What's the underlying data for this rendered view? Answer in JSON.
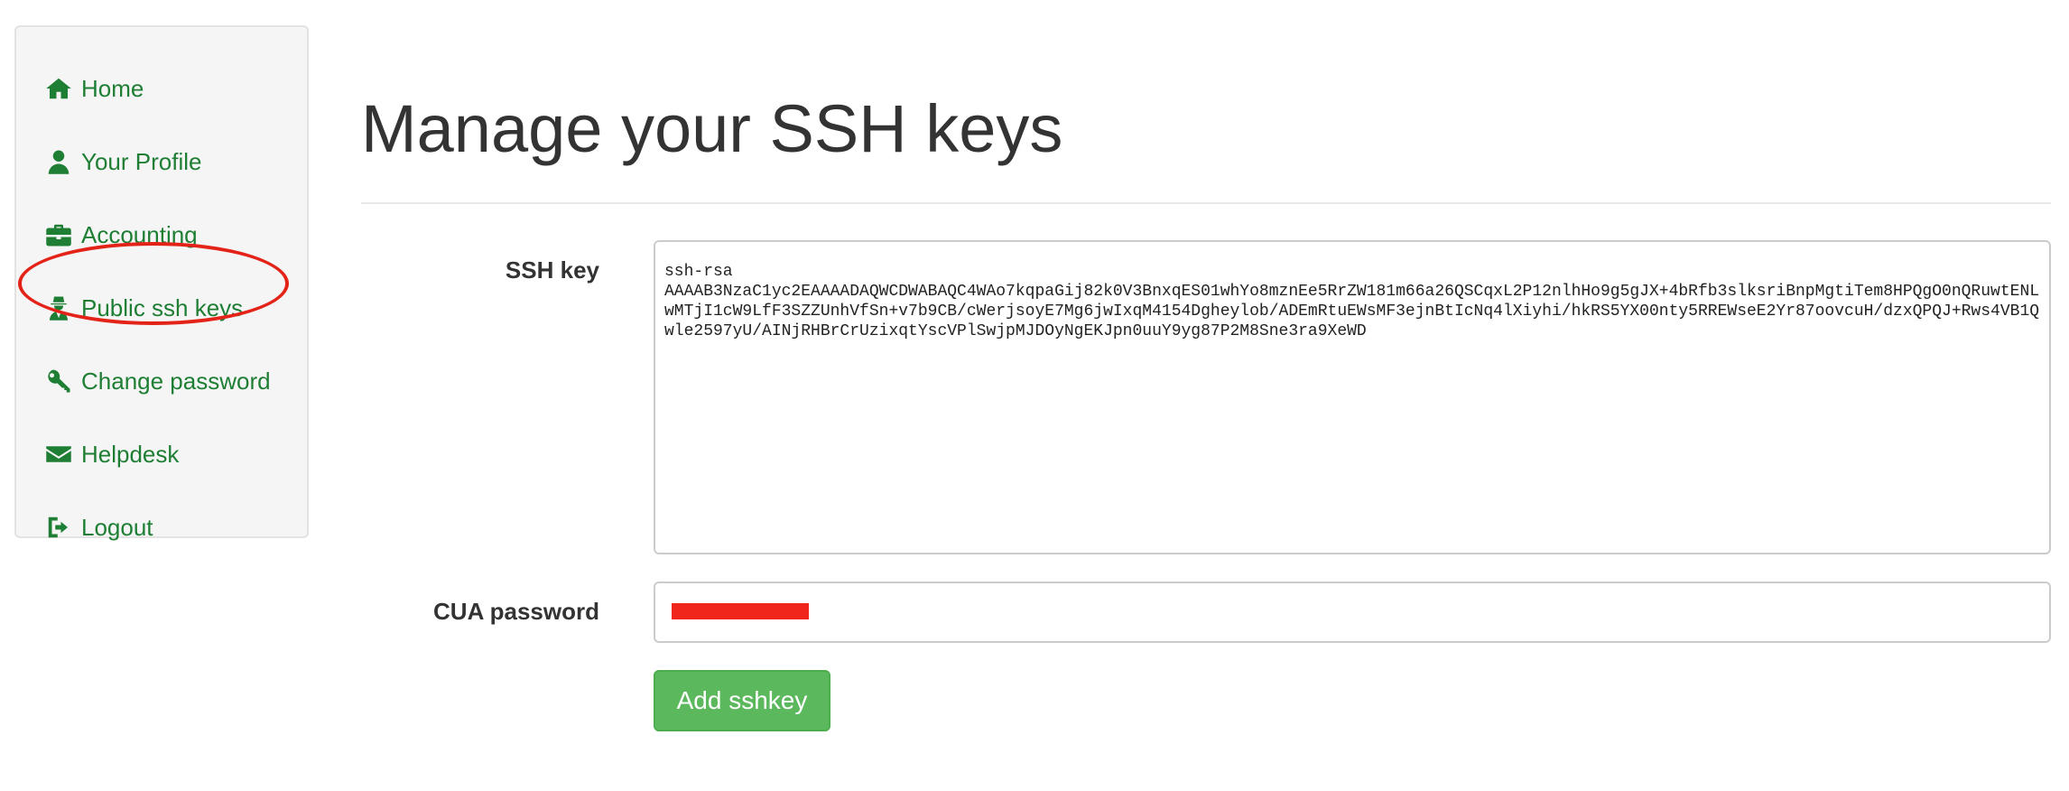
{
  "colors": {
    "link": "#1e7e34",
    "button": "#5cb85c",
    "highlight": "#e32218",
    "redaction": "#f0261c"
  },
  "sidebar": {
    "items": [
      {
        "label": "Home",
        "icon": "home-icon"
      },
      {
        "label": "Your Profile",
        "icon": "user-icon"
      },
      {
        "label": "Accounting",
        "icon": "briefcase-icon"
      },
      {
        "label": "Public ssh keys",
        "icon": "user-secret-icon",
        "highlighted": true
      },
      {
        "label": "Change password",
        "icon": "key-icon"
      },
      {
        "label": "Helpdesk",
        "icon": "envelope-icon"
      },
      {
        "label": "Logout",
        "icon": "sign-out-icon"
      }
    ]
  },
  "main": {
    "title": "Manage your SSH keys",
    "form": {
      "ssh_key_label": "SSH key",
      "ssh_key_value": "ssh-rsa\nAAAAB3NzaC1yc2EAAAADAQWCDWABAQC4WAo7kqpaGij82k0V3BnxqES01whYo8mznEe5RrZW181m66a26QSCqxL2P12nlhHo9g5gJX+4bRfb3slksriBnpMgtiTem8HPQgO0nQRuwtENLwMTjI1cW9LfF3SZZUnhVfSn+v7b9CB/cWerjsoyE7Mg6jwIxqM4154Dgheylob/ADEmRtuEWsMF3ejnBtIcNq4lXiyhi/hkRS5YX00nty5RREWseE2Yr87oovcuH/dzxQPQJ+Rws4VB1Qwle2597yU/AINjRHBrCrUzixqtYscVPlSwjpMJDOyNgEKJpn0uuY9yg87P2M8Sne3ra9XeWD",
      "password_label": "CUA password",
      "password_value": "",
      "submit_label": "Add sshkey"
    }
  }
}
